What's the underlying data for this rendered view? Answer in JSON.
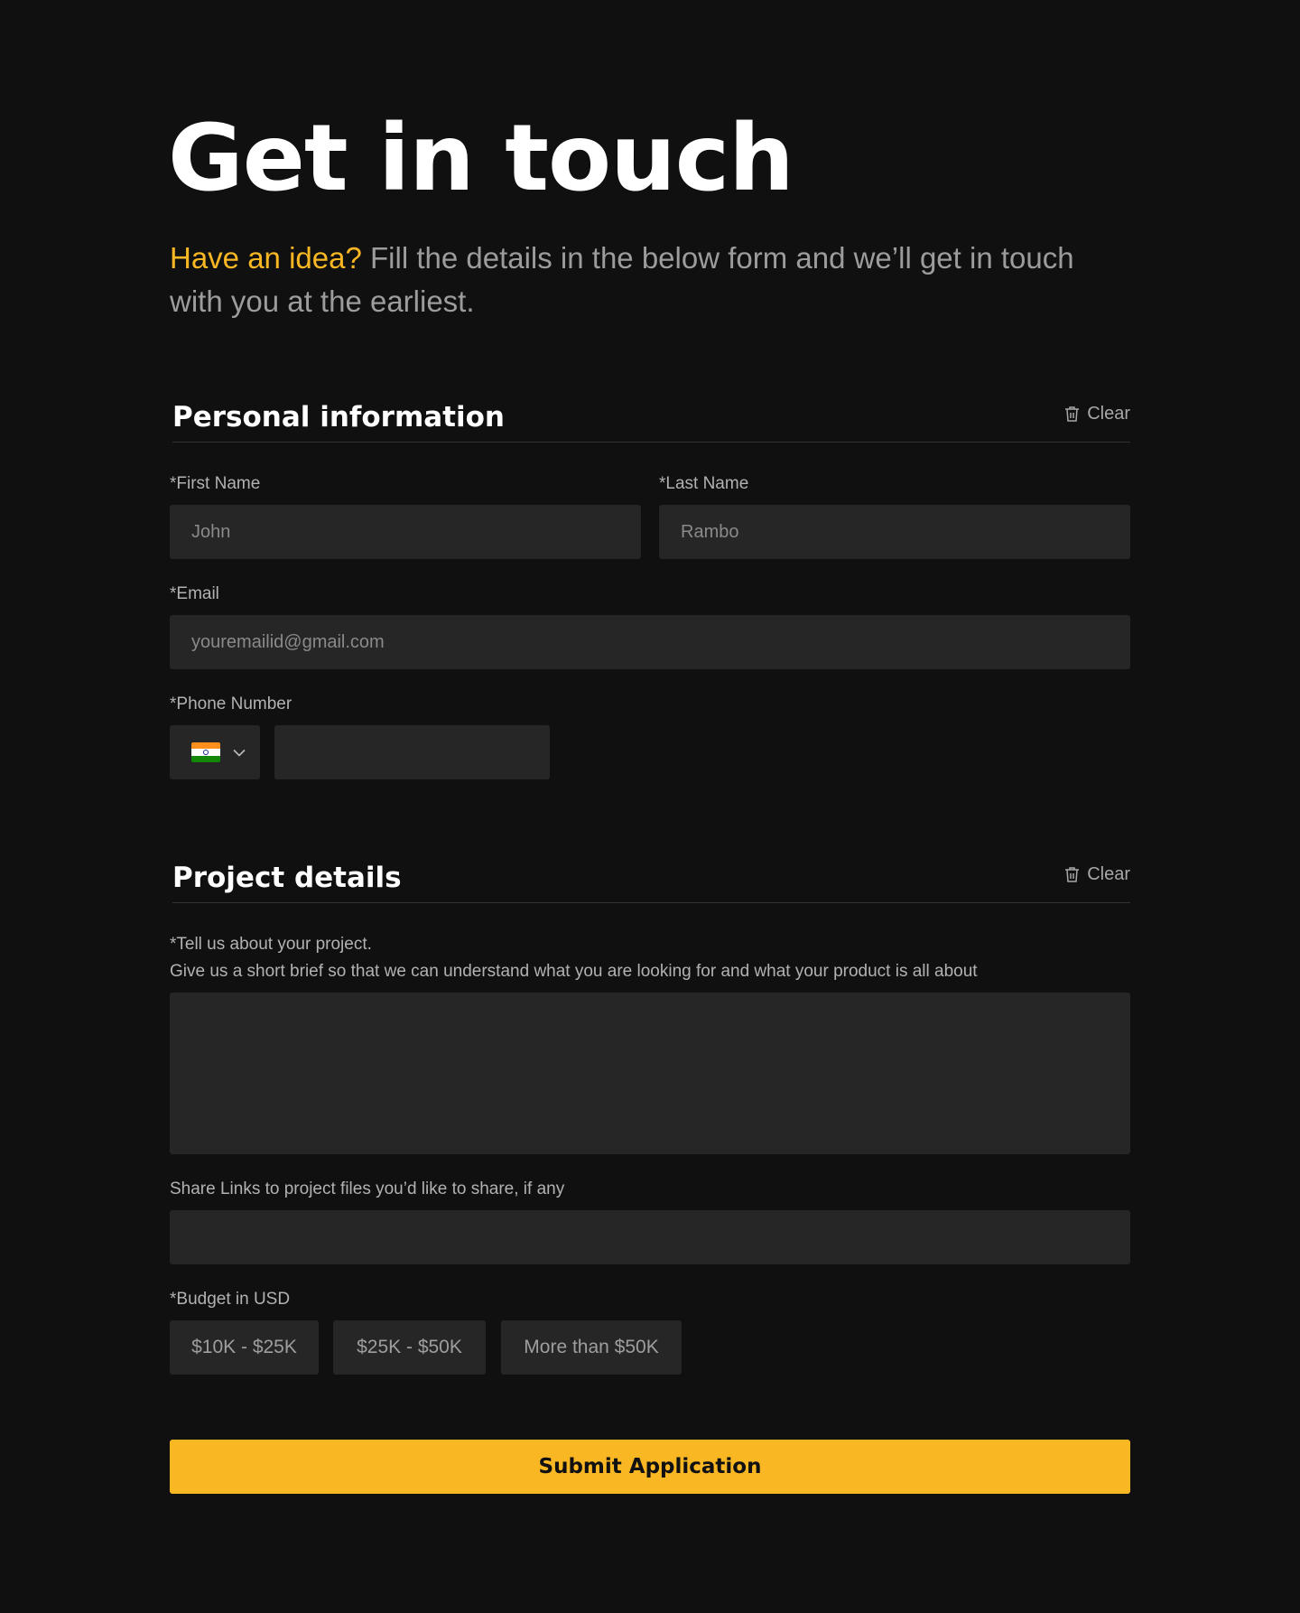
{
  "hero": {
    "title": "Get in touch",
    "intro_accent": "Have an idea?",
    "intro_rest": " Fill the details in the below form and we’ll get in touch with you at the earliest."
  },
  "personal": {
    "title": "Personal information",
    "clear_label": "Clear",
    "first_name_label": "*First Name",
    "first_name_placeholder": "John",
    "last_name_label": "*Last Name",
    "last_name_placeholder": "Rambo",
    "email_label": "*Email",
    "email_placeholder": "youremailid@gmail.com",
    "phone_label": "*Phone Number",
    "phone_country": "india-flag-icon",
    "phone_value": ""
  },
  "project": {
    "title": "Project details",
    "clear_label": "Clear",
    "about_label": "*Tell us about your project.",
    "about_hint": "Give us a short brief so that we can understand what you are looking for and what your product is all about",
    "about_value": "",
    "links_label": "Share Links to project files you’d like to share, if any",
    "links_value": "",
    "budget_label": "*Budget in USD",
    "budget_options": [
      "$10K - $25K",
      "$25K - $50K",
      "More than $50K"
    ]
  },
  "submit_label": "Submit Application",
  "colors": {
    "background": "#101010",
    "accent": "#f9b723",
    "field": "#262626"
  }
}
